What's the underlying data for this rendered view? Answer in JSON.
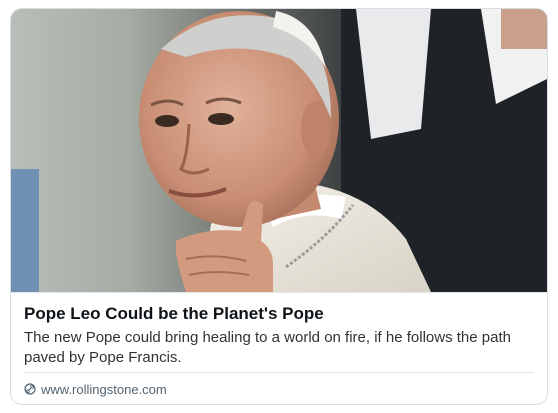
{
  "card": {
    "title": "Pope Leo Could be the Planet's Pope",
    "description": "The new Pope could bring healing to a world on fire, if he follows the path paved by Pope Francis.",
    "source_domain": "www.rollingstone.com",
    "source_icon": "link-icon"
  },
  "image": {
    "subject": "photo-of-pope-pointing"
  }
}
